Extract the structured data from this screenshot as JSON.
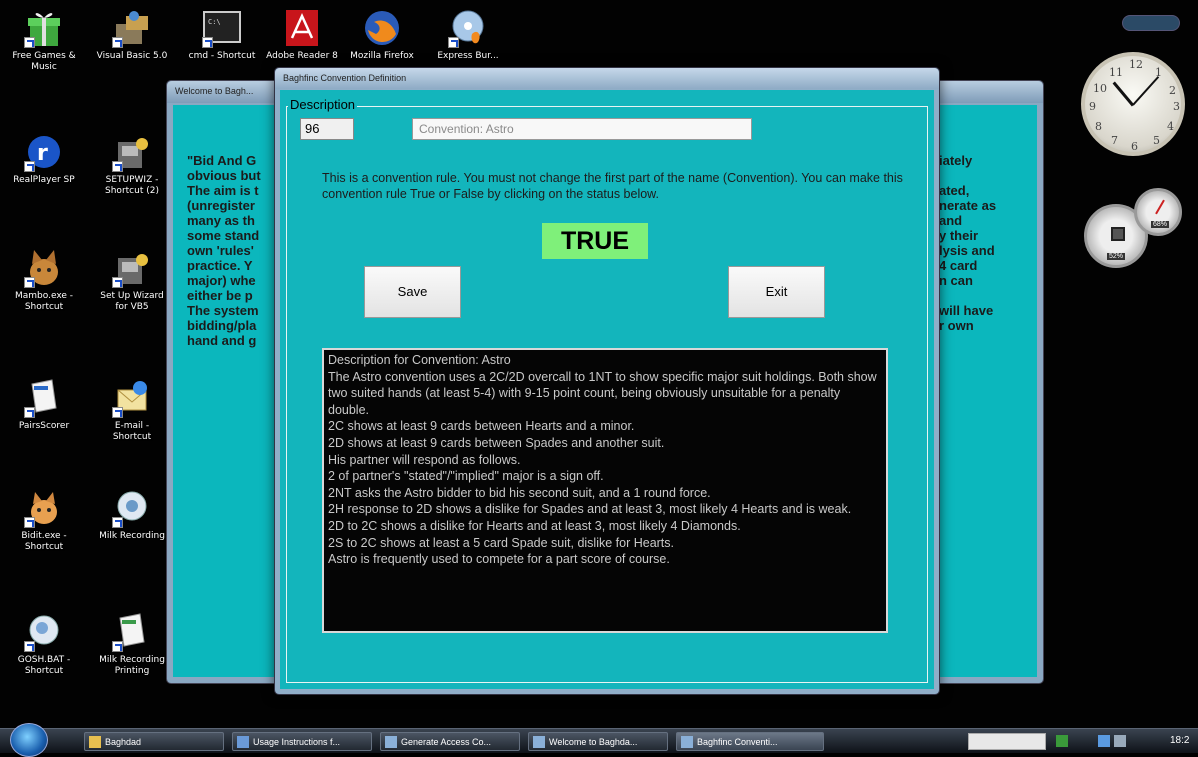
{
  "desktop_icons": [
    {
      "label": "Free Games & Music",
      "icon": "gift-icon"
    },
    {
      "label": "Visual Basic 5.0",
      "icon": "visual-basic-icon"
    },
    {
      "label": "cmd - Shortcut",
      "icon": "terminal-icon"
    },
    {
      "label": "Adobe Reader 8",
      "icon": "adobe-reader-icon"
    },
    {
      "label": "Mozilla Firefox",
      "icon": "firefox-icon"
    },
    {
      "label": "Express Bur...",
      "icon": "disc-burner-icon"
    },
    {
      "label": "RealPlayer SP",
      "icon": "realplayer-icon"
    },
    {
      "label": "SETUPWIZ - Shortcut (2)",
      "icon": "setup-wizard-icon"
    },
    {
      "label": "Mambo.exe - Shortcut",
      "icon": "cat-icon"
    },
    {
      "label": "Set Up Wizard for VB5",
      "icon": "setup-wizard-icon"
    },
    {
      "label": "PairsScorer",
      "icon": "document-icon"
    },
    {
      "label": "E-mail - Shortcut",
      "icon": "email-icon"
    },
    {
      "label": "Bidit.exe - Shortcut",
      "icon": "cat-icon"
    },
    {
      "label": "Milk Recording",
      "icon": "document-icon"
    },
    {
      "label": "GOSH.BAT - Shortcut",
      "icon": "batch-file-icon"
    },
    {
      "label": "Milk Recording Printing",
      "icon": "document-icon"
    }
  ],
  "background_window": {
    "title": "Welcome to Bagh...",
    "left_text": "\"Bid And G\nobvious but\nThe aim is t\n(unregister\nmany as th\nsome stand\nown 'rules'\npractice. Y\nmajor) whe\neither be p\nThe system\nbidding/pla\nhand and g",
    "right_text": "iately\n\nated,\nnerate as\nand\ny their\nlysis and\n4 card\nn can\n\nwill have\nr own"
  },
  "dialog": {
    "title": "Baghfinc Convention Definition",
    "group_label": "Description",
    "rule_number": "96",
    "rule_name": "Convention: Astro",
    "info_text": "This is a convention rule. You must not change the first part of the name (Convention). You can make this convention rule True or False by clicking on the status below.",
    "status": "TRUE",
    "save_label": "Save",
    "exit_label": "Exit",
    "description_lines": [
      "Description for Convention: Astro",
      "The Astro convention uses a 2C/2D overcall to 1NT to show specific major suit holdings. Both show two suited hands (at least 5-4) with 9-15 point count, being obviously unsuitable for a penalty double.",
      "2C shows at least 9 cards between Hearts and a minor.",
      "2D shows at least 9 cards between Spades and another suit.",
      "His partner will respond as follows.",
      "2 of partner's \"stated\"/\"implied\" major is a sign off.",
      "2NT asks the Astro bidder to bid his second suit, and a 1 round force.",
      "2H response to 2D shows a dislike for Spades and at least 3, most likely 4 Hearts and is weak.",
      "2D to 2C shows a dislike for Hearts and at least 3, most likely 4 Diamonds.",
      "2S to 2C shows at least a 5 card Spade suit, dislike for Hearts.",
      "Astro is frequently used to compete for a part score of course."
    ]
  },
  "taskbar": {
    "items": [
      {
        "label": "Baghdad",
        "active": false
      },
      {
        "label": "Usage Instructions f...",
        "active": false
      },
      {
        "label": "Generate Access Co...",
        "active": false
      },
      {
        "label": "Welcome to Baghda...",
        "active": false
      },
      {
        "label": "Baghfinc Conventi...",
        "active": true
      }
    ],
    "clock": "18:2"
  },
  "gadgets": {
    "clock_numbers": [
      "12",
      "1",
      "2",
      "3",
      "4",
      "5",
      "6",
      "7",
      "8",
      "9",
      "10",
      "11"
    ],
    "cpu_label": "52%",
    "mem_label": "68%"
  }
}
